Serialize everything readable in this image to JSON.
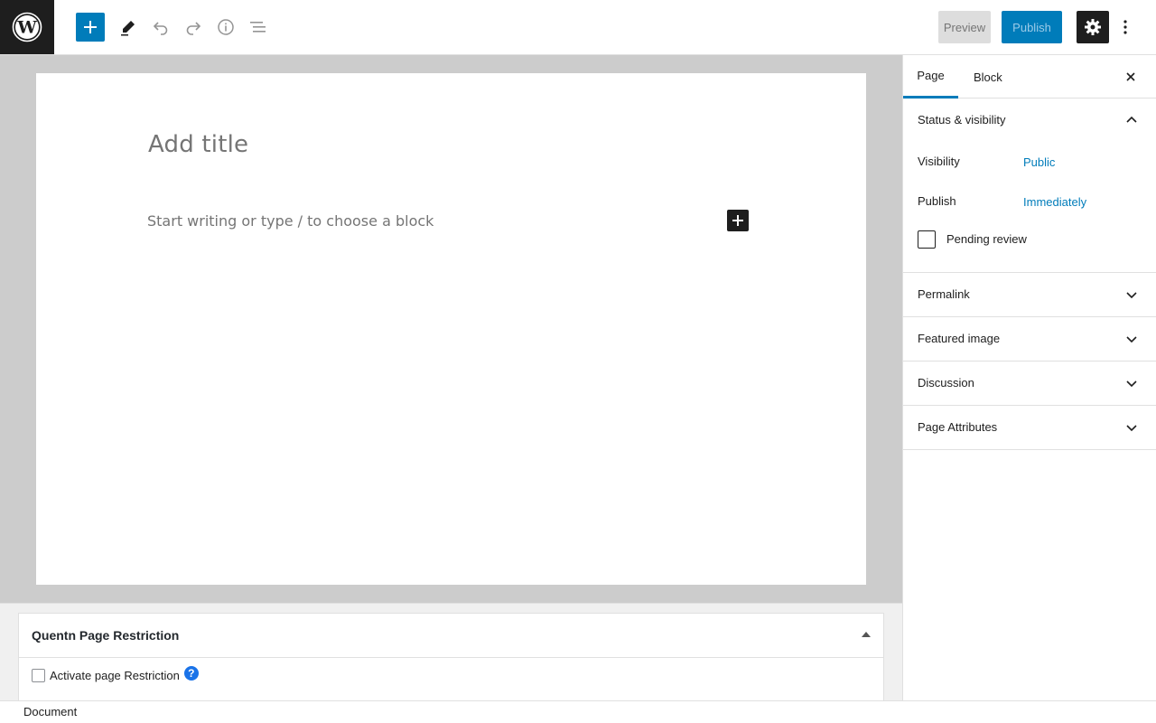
{
  "toolbar": {
    "preview_label": "Preview",
    "publish_label": "Publish"
  },
  "editor": {
    "title_placeholder": "Add title",
    "block_placeholder": "Start writing or type / to choose a block"
  },
  "metabox": {
    "title": "Quentn Page Restriction",
    "checkbox_label": "Activate page Restriction",
    "help_glyph": "?"
  },
  "footer": {
    "breadcrumb": "Document"
  },
  "sidebar": {
    "tabs": [
      {
        "label": "Page",
        "active": true
      },
      {
        "label": "Block",
        "active": false
      }
    ],
    "status_panel": {
      "title": "Status & visibility",
      "visibility_label": "Visibility",
      "visibility_value": "Public",
      "publish_label": "Publish",
      "publish_value": "Immediately",
      "pending_label": "Pending review"
    },
    "panels": [
      {
        "title": "Permalink"
      },
      {
        "title": "Featured image"
      },
      {
        "title": "Discussion"
      },
      {
        "title": "Page Attributes"
      }
    ]
  },
  "colors": {
    "accent": "#007cba",
    "dark": "#1e1e1e",
    "editor_bg": "#cccccc"
  }
}
